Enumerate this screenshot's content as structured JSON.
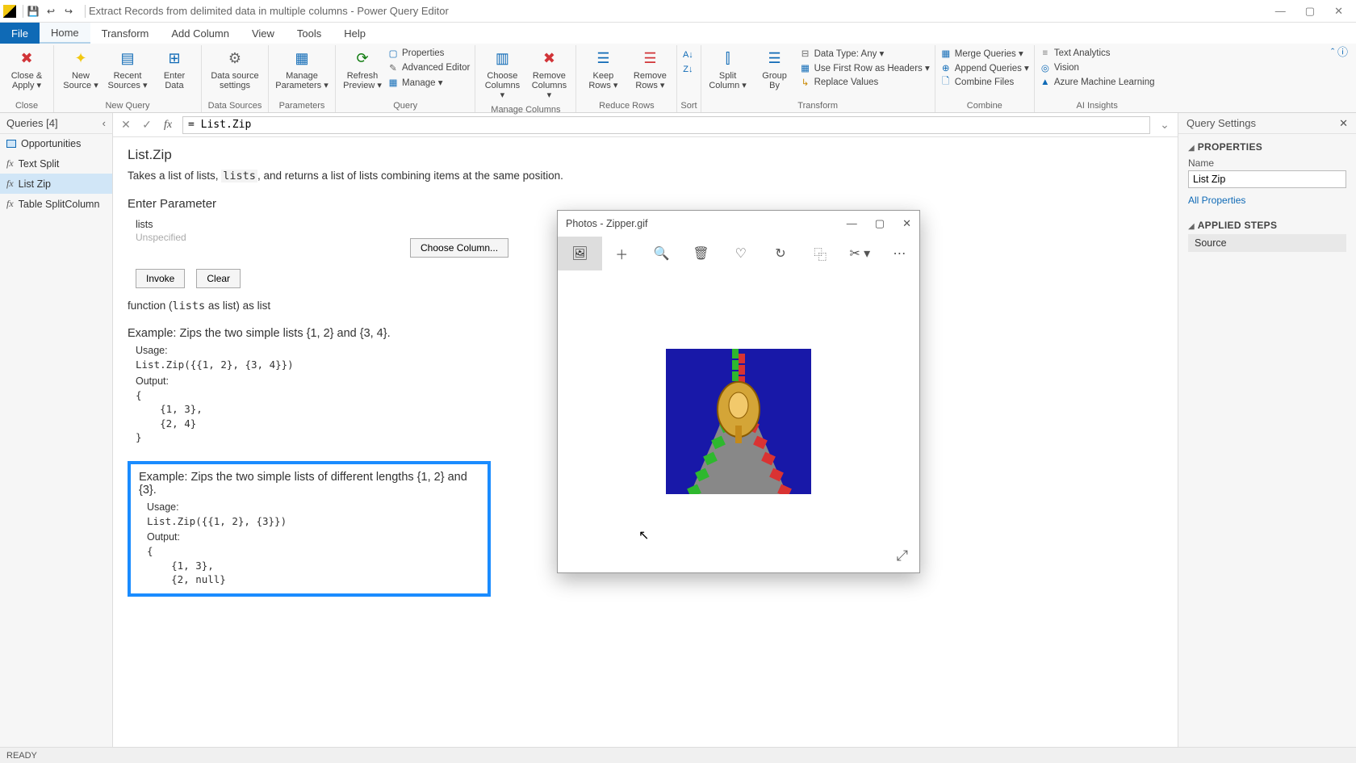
{
  "titlebar": {
    "title": "Extract Records from delimited data in multiple columns - Power Query Editor"
  },
  "tabs": {
    "file": "File",
    "home": "Home",
    "transform": "Transform",
    "addcolumn": "Add Column",
    "view": "View",
    "tools": "Tools",
    "help": "Help"
  },
  "ribbon": {
    "close": {
      "label": "Close &\nApply ▾",
      "group": "Close"
    },
    "newquery": {
      "new": "New\nSource ▾",
      "recent": "Recent\nSources ▾",
      "enter": "Enter\nData",
      "group": "New Query"
    },
    "datasources": {
      "btn": "Data source\nsettings",
      "group": "Data Sources"
    },
    "parameters": {
      "btn": "Manage\nParameters ▾",
      "group": "Parameters"
    },
    "query": {
      "refresh": "Refresh\nPreview ▾",
      "props": "Properties",
      "adv": "Advanced Editor",
      "manage": "Manage ▾",
      "group": "Query"
    },
    "managecols": {
      "choose": "Choose\nColumns ▾",
      "remove": "Remove\nColumns ▾",
      "group": "Manage Columns"
    },
    "reducerows": {
      "keep": "Keep\nRows ▾",
      "remove": "Remove\nRows ▾",
      "group": "Reduce Rows"
    },
    "sort": {
      "group": "Sort"
    },
    "transform": {
      "split": "Split\nColumn ▾",
      "groupby": "Group\nBy",
      "datatype": "Data Type: Any ▾",
      "firstrow": "Use First Row as Headers ▾",
      "replace": "Replace Values",
      "group": "Transform"
    },
    "combine": {
      "merge": "Merge Queries ▾",
      "append": "Append Queries ▾",
      "files": "Combine Files",
      "group": "Combine"
    },
    "ai": {
      "text": "Text Analytics",
      "vision": "Vision",
      "aml": "Azure Machine Learning",
      "group": "AI Insights"
    }
  },
  "queries": {
    "header": "Queries [4]",
    "items": [
      "Opportunities",
      "Text Split",
      "List Zip",
      "Table SplitColumn"
    ]
  },
  "formula": "= List.Zip",
  "doc": {
    "title": "List.Zip",
    "desc_pre": "Takes a list of lists, ",
    "desc_code": "lists",
    "desc_post": ", and returns a list of lists combining items at the same position.",
    "enter_param": "Enter Parameter",
    "param_name": "lists",
    "param_hint": "Unspecified",
    "choose": "Choose Column...",
    "invoke": "Invoke",
    "clear": "Clear",
    "sig_pre": "function (",
    "sig_mono": "lists",
    "sig_post": " as list) as list",
    "ex1": {
      "title": "Example: Zips the two simple lists {1, 2} and {3, 4}.",
      "usage_label": "Usage:",
      "usage": "List.Zip({{1, 2}, {3, 4}})",
      "output_label": "Output:",
      "output": "{\n    {1, 3},\n    {2, 4}\n}"
    },
    "ex2": {
      "title": "Example: Zips the two simple lists of different lengths {1, 2} and {3}.",
      "usage_label": "Usage:",
      "usage": "List.Zip({{1, 2}, {3}})",
      "output_label": "Output:",
      "output": "{\n    {1, 3},\n    {2, null}"
    }
  },
  "settings": {
    "header": "Query Settings",
    "props": "PROPERTIES",
    "name_label": "Name",
    "name_value": "List Zip",
    "all_props": "All Properties",
    "steps": "APPLIED STEPS",
    "step1": "Source"
  },
  "status": "READY",
  "photos": {
    "title": "Photos - Zipper.gif"
  }
}
